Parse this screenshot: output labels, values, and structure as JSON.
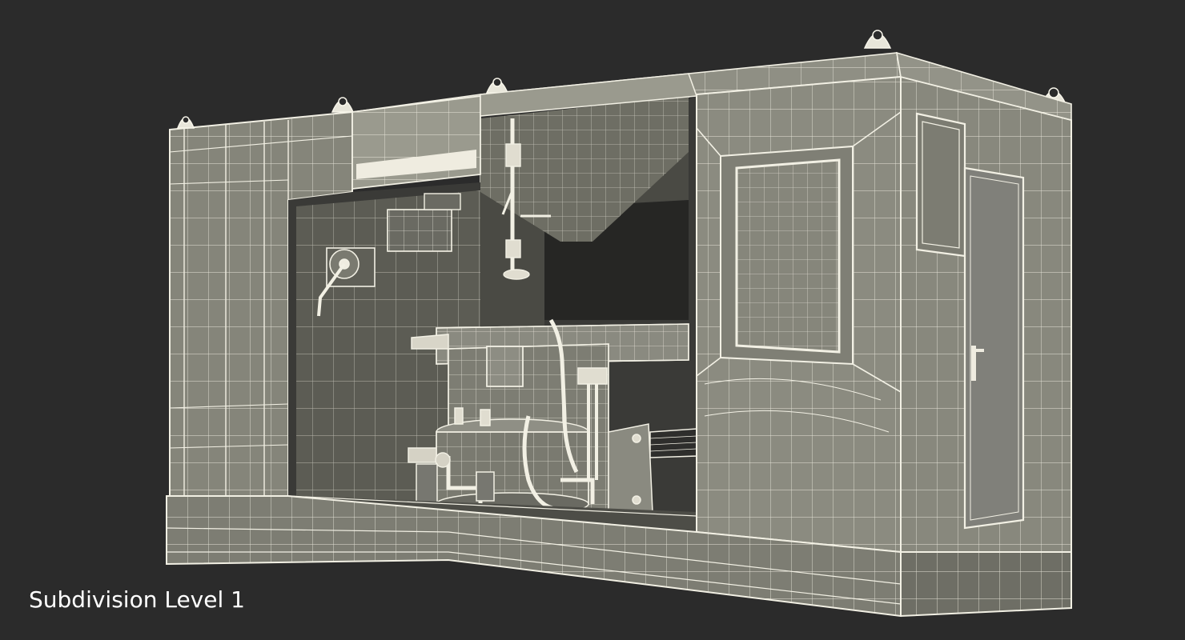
{
  "caption": "Subdivision Level 1",
  "colors": {
    "background": "#2b2b2b",
    "surface": "#8b8b7e",
    "surface_dark": "#6e6e64",
    "surface_shadow": "#55554d",
    "interior": "#3a3a37",
    "wire": "#f2f0e4"
  }
}
